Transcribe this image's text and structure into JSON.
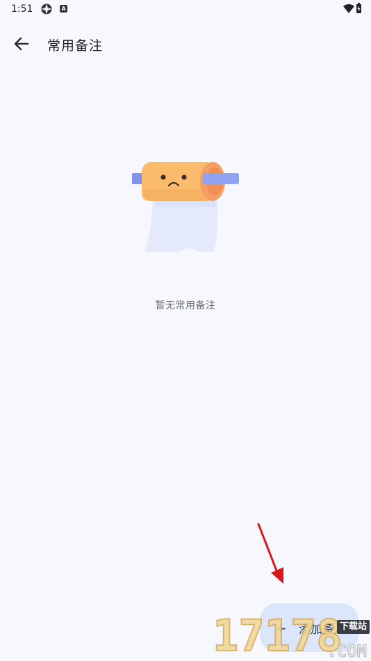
{
  "status_bar": {
    "time": "1:51",
    "icons": [
      "settings-icon",
      "a-badge-icon",
      "wifi-icon",
      "battery-charging-icon"
    ],
    "a_badge": "A"
  },
  "header": {
    "title": "常用备注",
    "back_icon": "arrow-left-icon"
  },
  "empty_state": {
    "illustration": "sad-paper-roll",
    "text": "暂无常用备注"
  },
  "add_button": {
    "icon": "plus-icon",
    "icon_glyph": "+",
    "label": "添加备注"
  },
  "annotation": {
    "arrow_color": "#d9181c"
  },
  "watermark": {
    "digits": "17178",
    "suffix": ".COM",
    "badge": "下载站"
  },
  "colors": {
    "background": "#f7f8fd",
    "button_bg": "#dbe6fb",
    "roll_orange": "#f9b96b",
    "roll_rod": "#8fa3f0",
    "paper": "#e4eafc"
  }
}
